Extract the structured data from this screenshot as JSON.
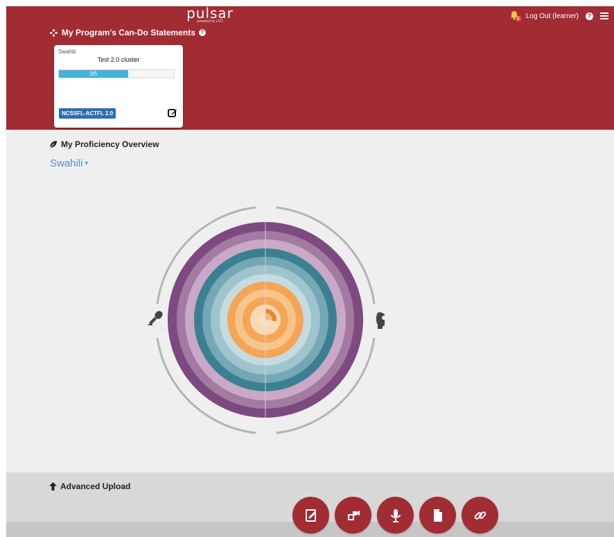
{
  "header": {
    "brand_name": "pulsar",
    "brand_tagline": "powered by LFO",
    "notification_count": "1",
    "logout_label": "Log Out (learner)",
    "help_glyph": "?",
    "statements_title": "My Program's Can-Do Statements"
  },
  "card": {
    "language": "Swahili",
    "title": "Test 2.0 cluster",
    "progress_label": "3/5",
    "progress_fraction": 0.6,
    "tag": "NCSSFL-ACTFL 2.0"
  },
  "overview": {
    "title": "My Proficiency Overview",
    "language_selected": "Swahili"
  },
  "footer": {
    "upload_title": "Advanced Upload",
    "buttons": [
      "writing-upload-icon",
      "video-upload-icon",
      "audio-upload-icon",
      "document-upload-icon",
      "link-upload-icon"
    ]
  },
  "colors": {
    "header_bg": "#a22c34",
    "accent_blue": "#4f8fd6",
    "progress_blue": "#45b3d8",
    "tag_blue": "#2f6db0",
    "ring_outer_purple": "#7d4a7f",
    "ring_light_purple": "#a27aa2",
    "ring_pale_purple": "#c9a8c8",
    "ring_teal": "#3b8091",
    "ring_light_teal": "#76a7b4",
    "ring_pale_teal": "#9ec4cd",
    "ring_orange": "#f4a556",
    "ring_pale_orange": "#f7c58a"
  }
}
